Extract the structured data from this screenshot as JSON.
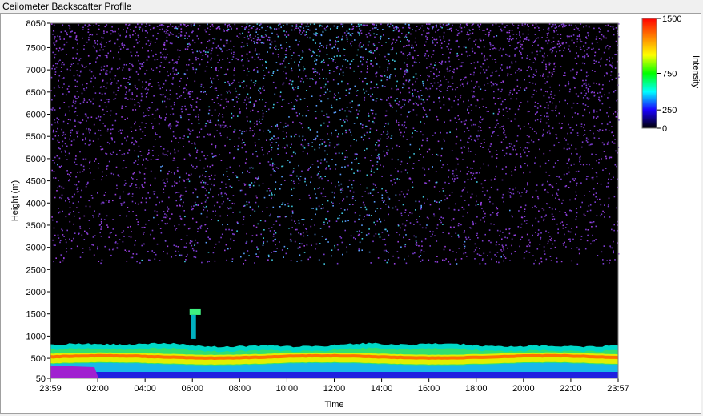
{
  "window": {
    "title": "Ceilometer Backscatter Profile"
  },
  "chart_data": {
    "type": "heatmap",
    "xlabel": "Time",
    "ylabel": "Height (m)",
    "x_ticks": [
      "23:59",
      "02:00",
      "04:00",
      "06:00",
      "08:00",
      "10:00",
      "12:00",
      "14:00",
      "16:00",
      "18:00",
      "20:00",
      "22:00",
      "23:57"
    ],
    "y_ticks": [
      50,
      500,
      1000,
      1500,
      2000,
      2500,
      3000,
      3500,
      4000,
      4500,
      5000,
      5500,
      6000,
      6500,
      7000,
      7500,
      8050
    ],
    "ylim": [
      50,
      8050
    ],
    "colorbar": {
      "label": "Intensity",
      "ticks": [
        0,
        250,
        750,
        1500
      ],
      "range": [
        0,
        1500
      ],
      "stops": [
        "#000000",
        "#1a00ff",
        "#00ffff",
        "#00ff00",
        "#ffff00",
        "#ff8000",
        "#ff0000"
      ]
    },
    "features": {
      "boundary_layer_top_m": 550,
      "aerosol_layer_m": [
        50,
        800
      ],
      "noise_region_m": [
        3000,
        8050
      ],
      "elevated_layer": {
        "time": "06:00",
        "height_m": 1550
      }
    }
  }
}
